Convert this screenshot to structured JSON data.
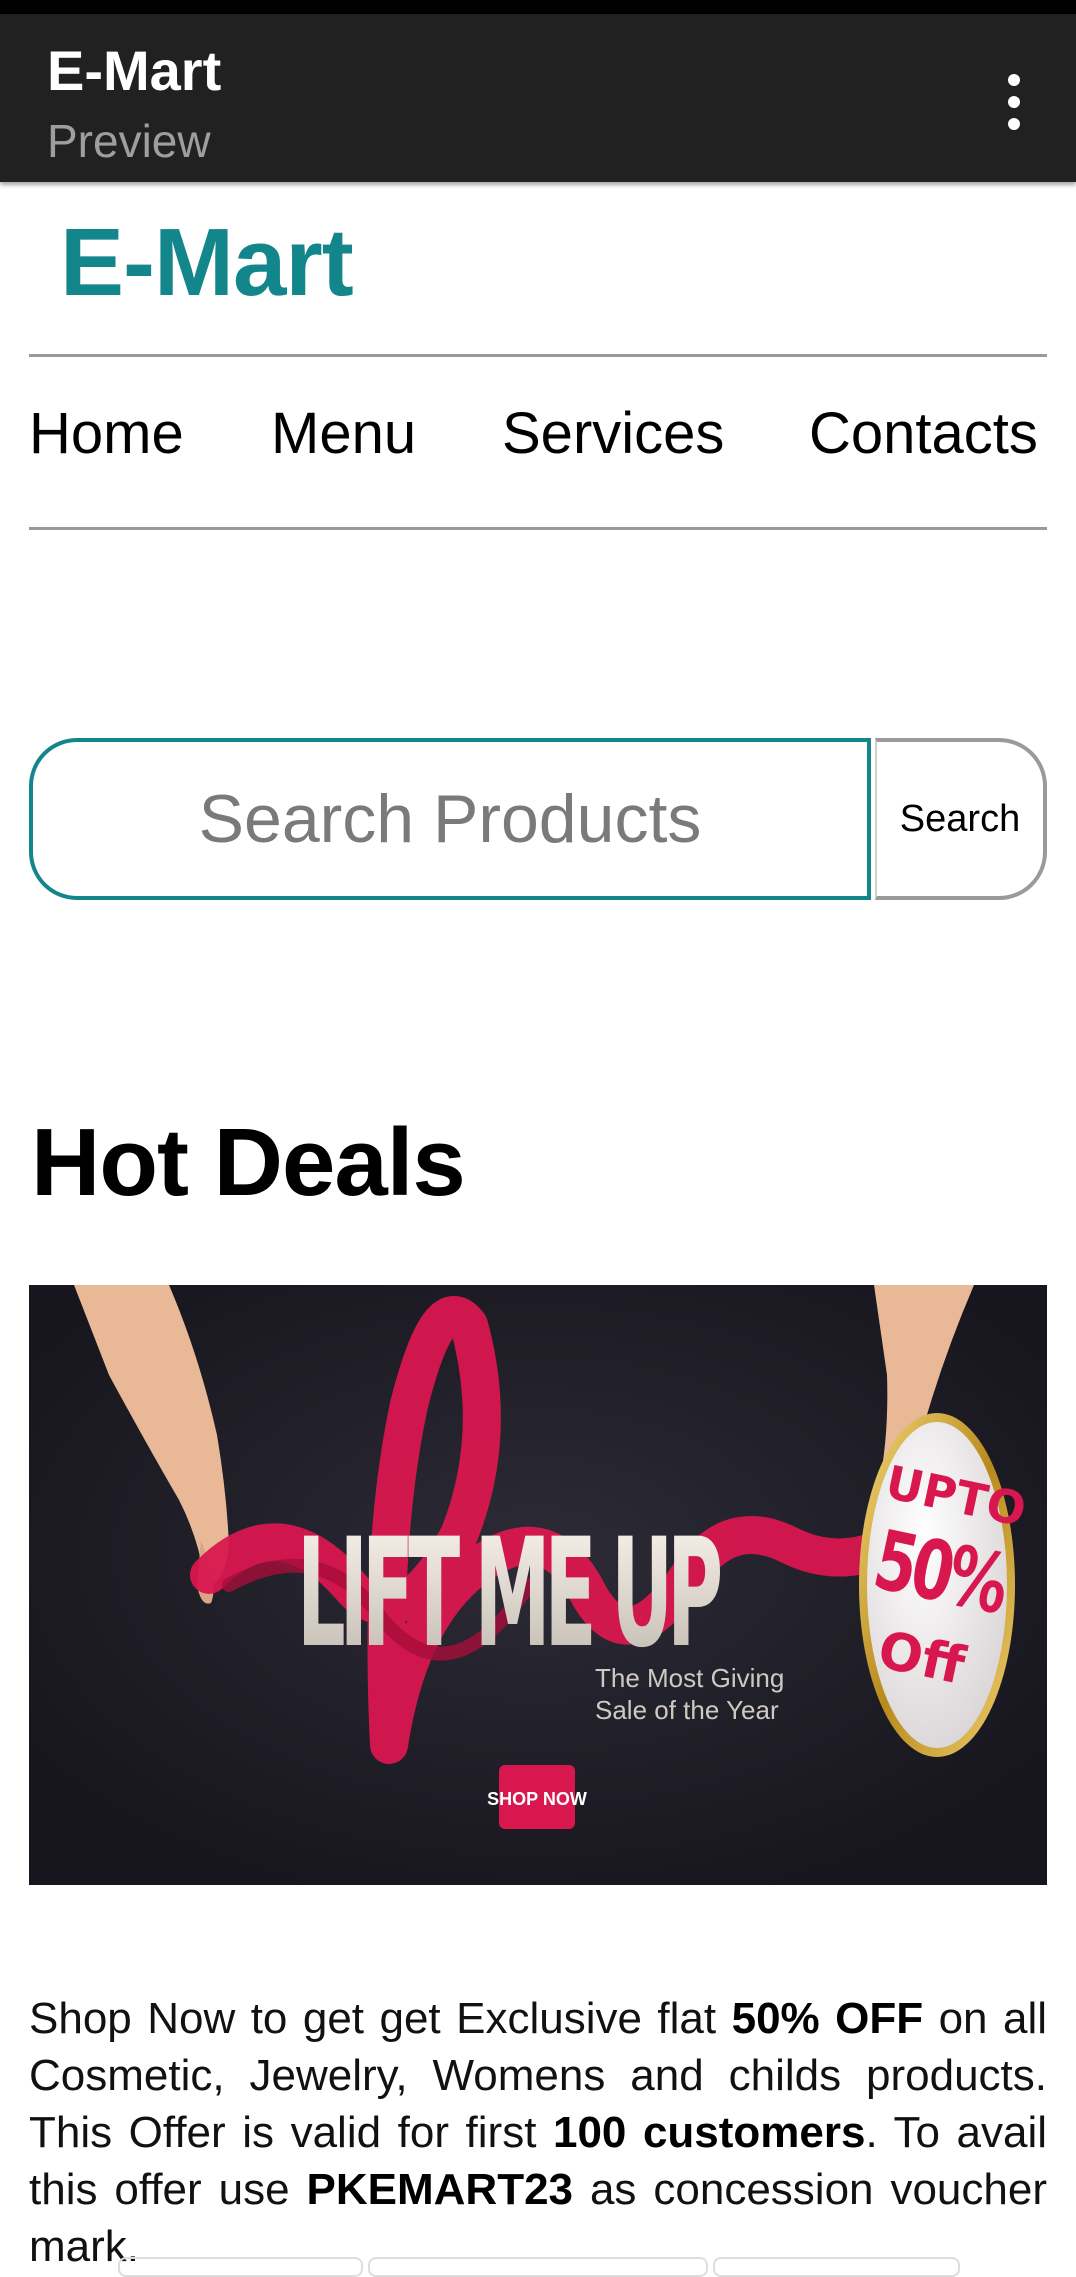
{
  "appbar": {
    "title": "E-Mart",
    "subtitle": "Preview",
    "menu_icon": "more-vert-icon"
  },
  "header": {
    "brand": "E-Mart"
  },
  "nav": {
    "items": [
      "Home",
      "Menu",
      "Services",
      "Contacts"
    ]
  },
  "search": {
    "placeholder": "Search Products",
    "button_label": "Search"
  },
  "deals": {
    "title": "Hot Deals",
    "banner": {
      "headline": "LIFT ME UP",
      "tagline_line1": "The Most Giving",
      "tagline_line2": "Sale of the Year",
      "cta": "SHOP NOW",
      "badge_line1": "UPTO",
      "badge_line2": "50%",
      "badge_line3": "Off"
    },
    "promo": {
      "p1": "Shop Now to get get Exclusive flat ",
      "b1": "50% OFF",
      "p2": " on all Cosmetic, Jewelry, Womens and childs products. This Offer is valid for first ",
      "b2": "100 customers",
      "p3": ". To avail this offer use ",
      "b3": "PKEMART23",
      "p4": " as concession voucher mark."
    }
  },
  "colors": {
    "brand": "#12868a",
    "appbar": "#212121",
    "banner_bg": "#1d1c26",
    "ribbon": "#d9174f",
    "gold": "#c9a227"
  }
}
